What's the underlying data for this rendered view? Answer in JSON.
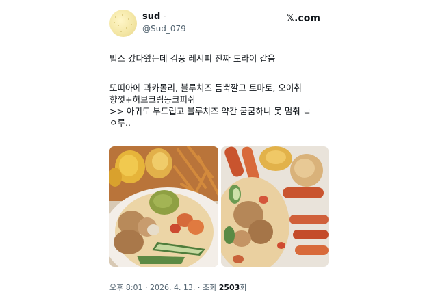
{
  "tweet": {
    "display_name": "sud",
    "name_mark": "ᆞ",
    "handle": "@Sud_079",
    "source": ".com",
    "lines": [
      "빕스 갔다왔는데 김풍 레시피 진짜 도라이 같음",
      "또띠아에 과카몰리, 블루치즈 듬뿍깔고 토마토, 오이취",
      "향껏+허브크림몽크피쉬",
      ">> 아귀도 부드럽고 블루치즈 약간 쿰쿰하니 못 멈춰 ㄹ",
      "ㅇ루.."
    ],
    "meta": {
      "time": "오후 8:01",
      "date": "2026. 4. 13.",
      "views_label": "조회",
      "views_count": "2503",
      "views_suffix": "회"
    }
  },
  "images": {
    "left": "food-photo-tortilla-guacamole-monkfish",
    "right": "food-photo-tortilla-crab-legs"
  }
}
